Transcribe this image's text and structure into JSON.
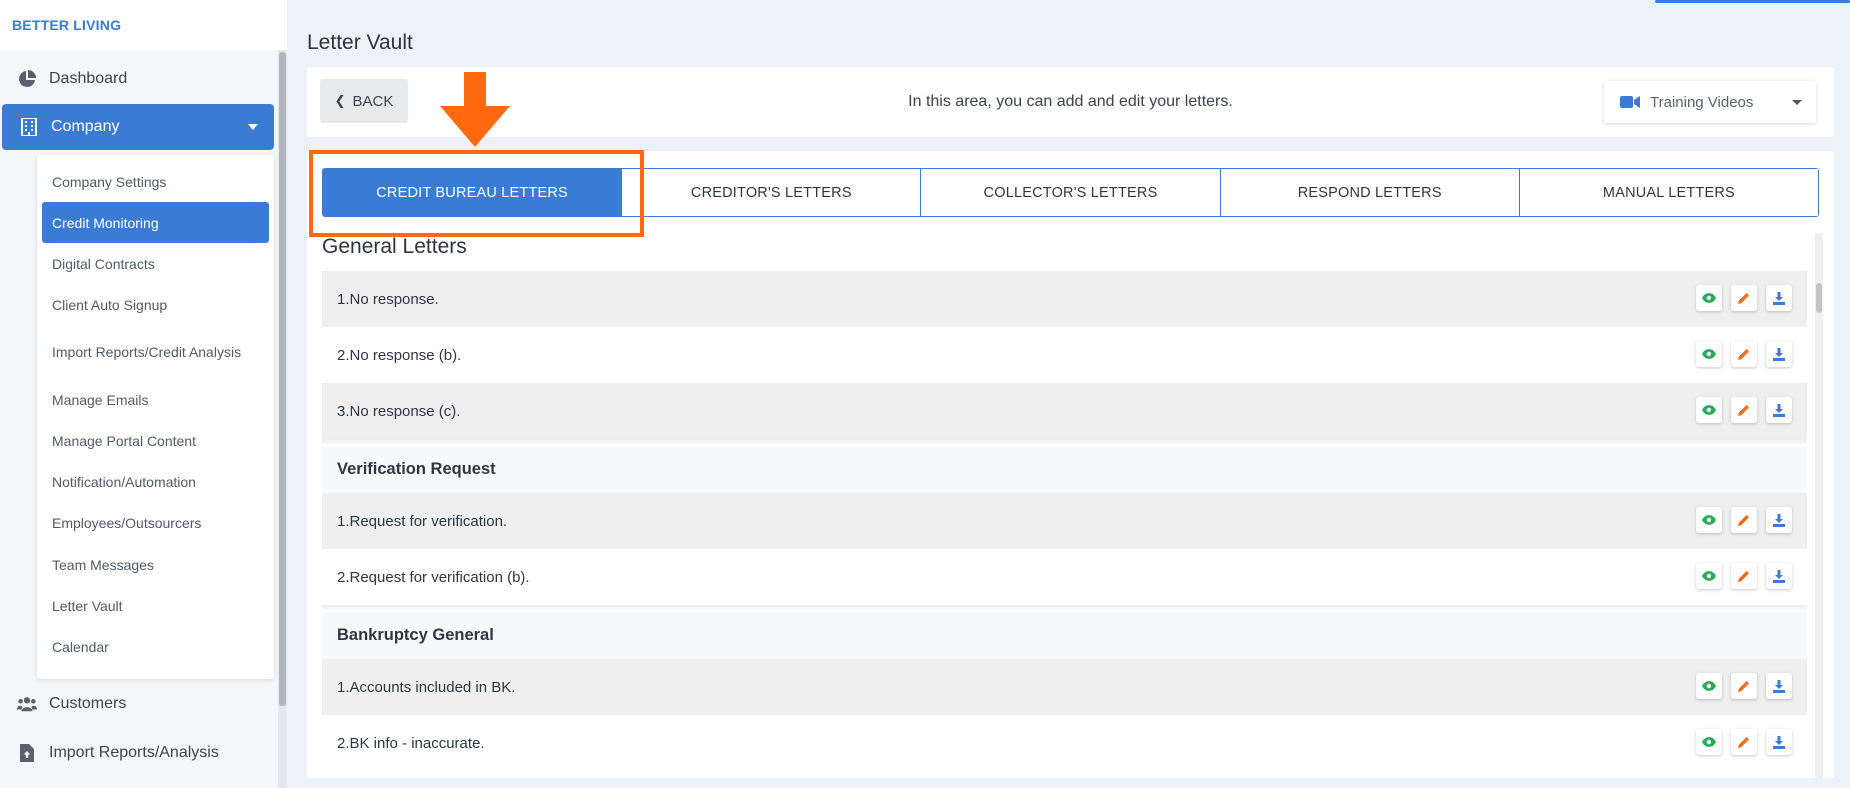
{
  "brand": "BETTER LIVING",
  "colors": {
    "accent": "#3a7bd5",
    "annotation": "#ff6a10",
    "view": "#2eaa5c",
    "edit": "#ef6a1a",
    "download": "#3a7bd5"
  },
  "sidebar": {
    "dashboard": {
      "label": "Dashboard",
      "icon": "pie-chart-icon"
    },
    "company": {
      "label": "Company",
      "icon": "building-icon"
    },
    "submenu": [
      "Company Settings",
      "Credit Monitoring",
      "Digital Contracts",
      "Client Auto Signup",
      "Import Reports/Credit Analysis",
      "Manage Emails",
      "Manage Portal Content",
      "Notification/Automation",
      "Employees/Outsourcers",
      "Team Messages",
      "Letter Vault",
      "Calendar"
    ],
    "customers": {
      "label": "Customers",
      "icon": "users-icon"
    },
    "import": {
      "label": "Import Reports/Analysis",
      "icon": "file-upload-icon"
    }
  },
  "page": {
    "title": "Letter Vault",
    "back_label": "BACK",
    "description": "In this area, you can add and edit your letters.",
    "training_label": "Training Videos"
  },
  "tabs": [
    "CREDIT BUREAU LETTERS",
    "CREDITOR'S LETTERS",
    "COLLECTOR'S LETTERS",
    "RESPOND LETTERS",
    "MANUAL LETTERS"
  ],
  "sections": {
    "general": {
      "title": "General Letters",
      "items": [
        "1.No response.",
        "2.No response (b).",
        "3.No response (c)."
      ]
    },
    "verification": {
      "title": "Verification Request",
      "items": [
        "1.Request for verification.",
        "2.Request for verification (b)."
      ]
    },
    "bankruptcy": {
      "title": "Bankruptcy General",
      "items": [
        "1.Accounts included in BK.",
        "2.BK info - inaccurate."
      ]
    }
  }
}
